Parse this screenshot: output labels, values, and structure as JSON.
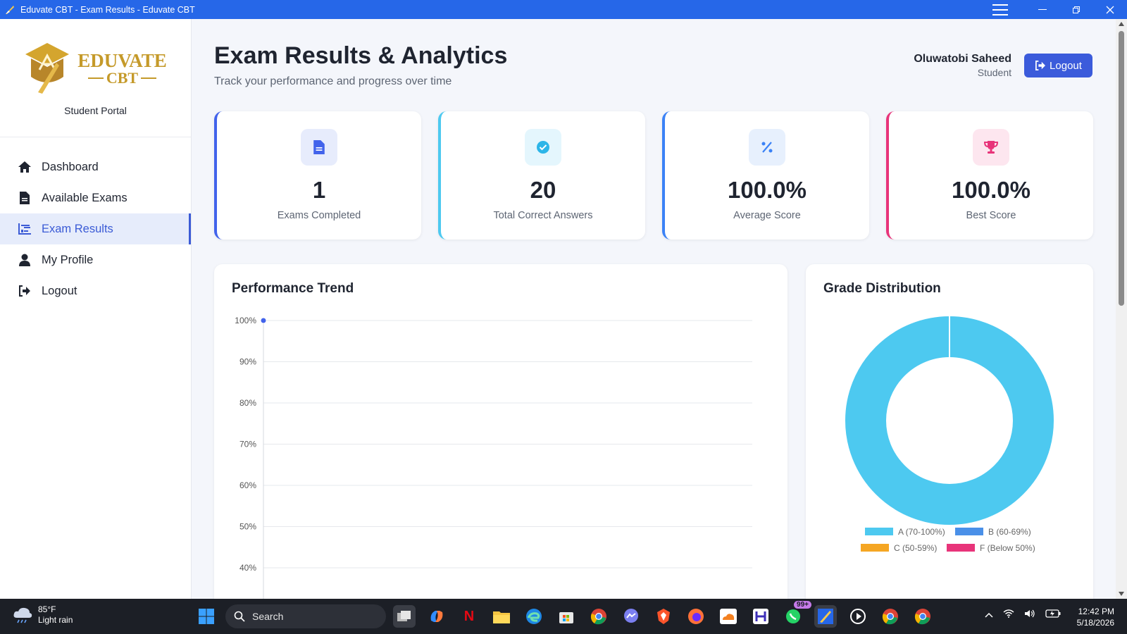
{
  "window": {
    "title": "Eduvate CBT - Exam Results - Eduvate CBT"
  },
  "sidebar": {
    "logo": {
      "line1": "EDUVATE",
      "line2": "CBT"
    },
    "portal_label": "Student Portal",
    "items": [
      {
        "label": "Dashboard",
        "icon": "home-icon"
      },
      {
        "label": "Available Exams",
        "icon": "file-icon"
      },
      {
        "label": "Exam Results",
        "icon": "chart-icon",
        "active": true
      },
      {
        "label": "My Profile",
        "icon": "user-icon"
      },
      {
        "label": "Logout",
        "icon": "logout-icon"
      }
    ]
  },
  "header": {
    "title": "Exam Results & Analytics",
    "subtitle": "Track your performance and progress over time",
    "user_name": "Oluwatobi Saheed",
    "user_role": "Student",
    "logout_label": "Logout"
  },
  "stats": [
    {
      "value": "1",
      "label": "Exams Completed",
      "icon": "document-icon",
      "color": "#4263eb"
    },
    {
      "value": "20",
      "label": "Total Correct Answers",
      "icon": "check-circle-icon",
      "color": "#2cb5e8"
    },
    {
      "value": "100.0%",
      "label": "Average Score",
      "icon": "percent-icon",
      "color": "#3b82f6"
    },
    {
      "value": "100.0%",
      "label": "Best Score",
      "icon": "trophy-icon",
      "color": "#e83e8c"
    }
  ],
  "performance": {
    "title": "Performance Trend"
  },
  "grades": {
    "title": "Grade Distribution"
  },
  "chart_data": [
    {
      "type": "line",
      "title": "Performance Trend",
      "y_ticks": [
        "100%",
        "90%",
        "80%",
        "70%",
        "60%",
        "50%",
        "40%"
      ],
      "ylim": [
        40,
        100
      ],
      "series": [
        {
          "values": [
            100
          ]
        }
      ],
      "grid": true
    },
    {
      "type": "pie",
      "title": "Grade Distribution",
      "labels": [
        "A (70-100%)",
        "B (60-69%)",
        "C (50-59%)",
        "F (Below 50%)"
      ],
      "values": [
        1,
        0,
        0,
        0
      ],
      "colors": [
        "#4dc9f0",
        "#4a90e8",
        "#f5a623",
        "#e8347a"
      ],
      "legend": "bottom"
    }
  ],
  "taskbar": {
    "weather_temp": "85°F",
    "weather_desc": "Light rain",
    "search_label": "Search",
    "notif_badge": "99+",
    "time": "12:42 PM",
    "date": "5/18/2026"
  }
}
